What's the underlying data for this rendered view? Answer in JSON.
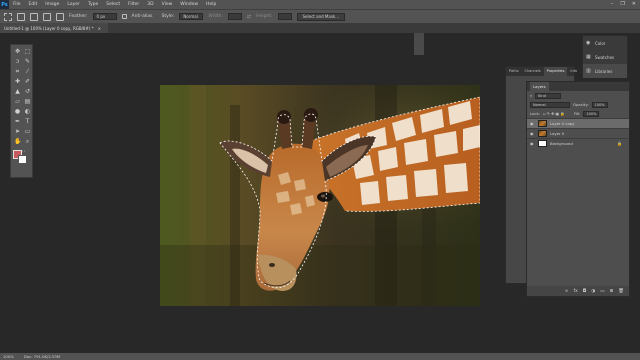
{
  "app": {
    "logo": "Ps"
  },
  "menu": [
    "File",
    "Edit",
    "Image",
    "Layer",
    "Type",
    "Select",
    "Filter",
    "3D",
    "View",
    "Window",
    "Help"
  ],
  "window_controls": [
    "–",
    "❐",
    "✕"
  ],
  "options_bar": {
    "feather_label": "Feather:",
    "feather_value": "0 px",
    "antialias_label": "Anti-alias",
    "style_label": "Style:",
    "style_value": "Normal",
    "width_label": "Width:",
    "height_label": "Height:",
    "select_mask_button": "Select and Mask..."
  },
  "document_tab": {
    "title": "Untitled-1 @ 100% (Layer 0 copy, RGB/8#) *",
    "close": "×"
  },
  "colors": {
    "foreground": "#c65a5f",
    "background": "#ffffff"
  },
  "side_panel": [
    {
      "label": "Color",
      "icon": "color-wheel-icon"
    },
    {
      "label": "Swatches",
      "icon": "swatches-grid-icon"
    },
    {
      "label": "Libraries",
      "icon": "libraries-icon"
    }
  ],
  "panel_back_tabs": [
    "Paths",
    "Channels",
    "Properties",
    "Info"
  ],
  "layers_panel": {
    "title": "Layers",
    "filter_kind": "Kind",
    "blend_mode": "Normal",
    "opacity_label": "Opacity:",
    "opacity_value": "100%",
    "lock_label": "Lock:",
    "fill_label": "Fill:",
    "fill_value": "100%",
    "layers": [
      {
        "name": "Layer 0 copy",
        "selected": true,
        "thumb": "giraffe"
      },
      {
        "name": "Layer 0",
        "selected": false,
        "thumb": "giraffe"
      },
      {
        "name": "Background",
        "selected": false,
        "thumb": "white",
        "locked": true
      }
    ]
  },
  "status_bar": {
    "zoom": "100%",
    "doc": "Doc: 791.0K/2.53M"
  }
}
